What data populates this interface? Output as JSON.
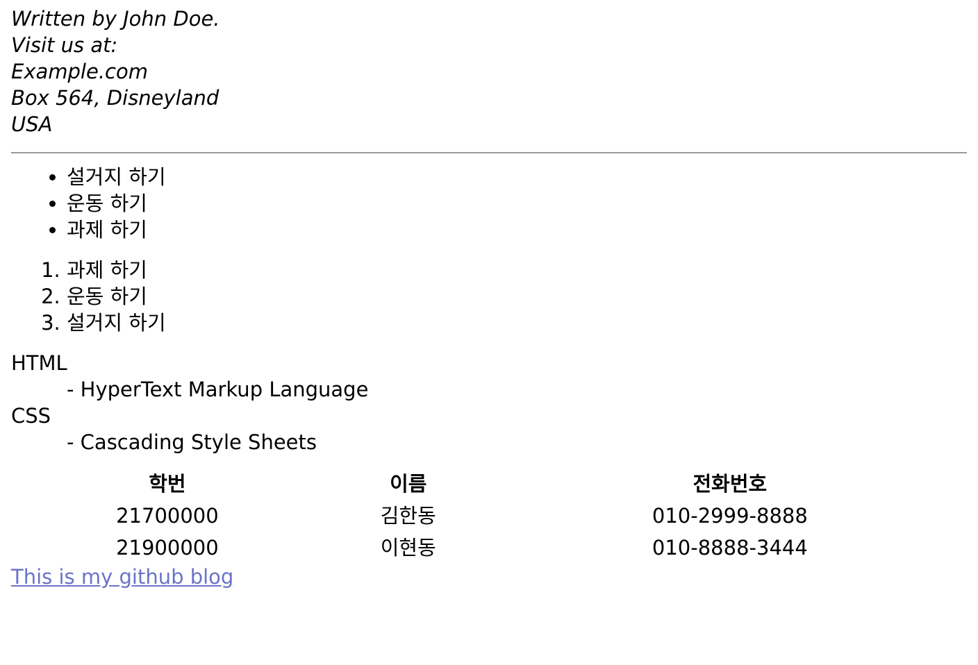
{
  "address": {
    "lines": [
      "Written by John Doe.",
      "Visit us at:",
      "Example.com",
      "Box 564, Disneyland",
      "USA"
    ]
  },
  "unordered_list": [
    "설거지 하기",
    "운동 하기",
    "과제 하기"
  ],
  "ordered_list": [
    "과제 하기",
    "운동 하기",
    "설거지 하기"
  ],
  "definitions": [
    {
      "term": "HTML",
      "description": "- HyperText Markup Language"
    },
    {
      "term": "CSS",
      "description": "- Cascading Style Sheets"
    }
  ],
  "table": {
    "headers": [
      "학번",
      "이름",
      "전화번호"
    ],
    "rows": [
      [
        "21700000",
        "김한동",
        "010-2999-8888"
      ],
      [
        "21900000",
        "이현동",
        "010-8888-3444"
      ]
    ]
  },
  "link": {
    "label": "This is my github blog"
  },
  "colors": {
    "link": "#6b73c8",
    "rule": "#9a9a9a"
  }
}
